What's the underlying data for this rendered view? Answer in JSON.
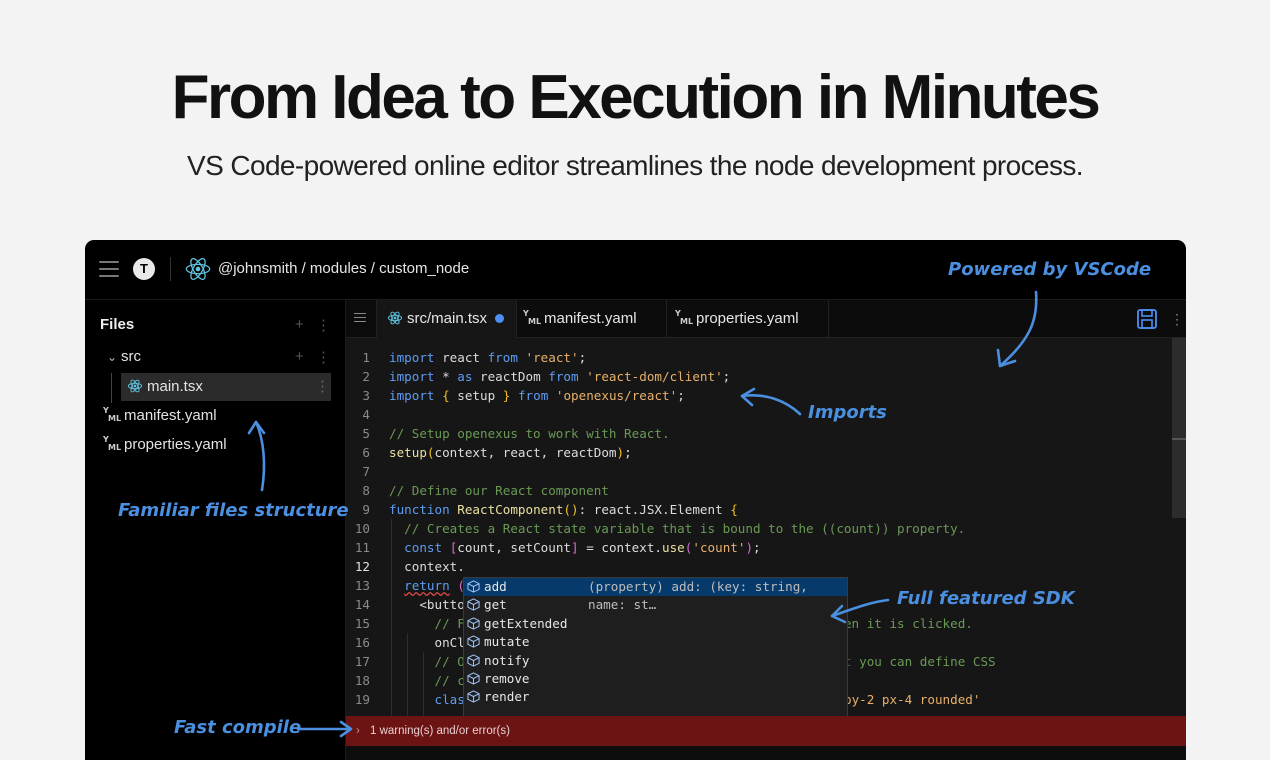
{
  "hero": {
    "title": "From Idea to Execution in Minutes",
    "subtitle": "VS Code-powered online editor streamlines the node development process."
  },
  "header": {
    "avatar_initial": "T",
    "breadcrumb": "@johnsmith / modules / custom_node"
  },
  "sidebar": {
    "title": "Files",
    "add": "+",
    "more": "⋮",
    "folder": "src",
    "items": [
      "main.tsx",
      "manifest.yaml",
      "properties.yaml"
    ]
  },
  "tabs": [
    {
      "label": "src/main.tsx",
      "modified": true
    },
    {
      "label": "manifest.yaml",
      "modified": false
    },
    {
      "label": "properties.yaml",
      "modified": false
    }
  ],
  "code": {
    "line_numbers": [
      "1",
      "2",
      "3",
      "4",
      "5",
      "6",
      "7",
      "8",
      "9",
      "10",
      "11",
      "12",
      "13",
      "14",
      "15",
      "16",
      "17",
      "18",
      "19"
    ],
    "current_line": "12"
  },
  "suggestions": {
    "items": [
      "add",
      "get",
      "getExtended",
      "mutate",
      "notify",
      "remove",
      "render"
    ],
    "selected_detail": "(property) add: (key: string, name: st…"
  },
  "status": {
    "error_text": "1 warning(s) and/or error(s)"
  },
  "annotations": {
    "vscode": "Powered by VSCode",
    "imports": "Imports",
    "files": "Familiar files structure",
    "sdk": "Full featured SDK",
    "compile": "Fast compile"
  },
  "colors": {
    "accent": "#4a8fe0",
    "error_bar": "#6c1414",
    "keyword": "#5f9cf3",
    "string": "#e8b06a",
    "comment": "#6a9955"
  }
}
